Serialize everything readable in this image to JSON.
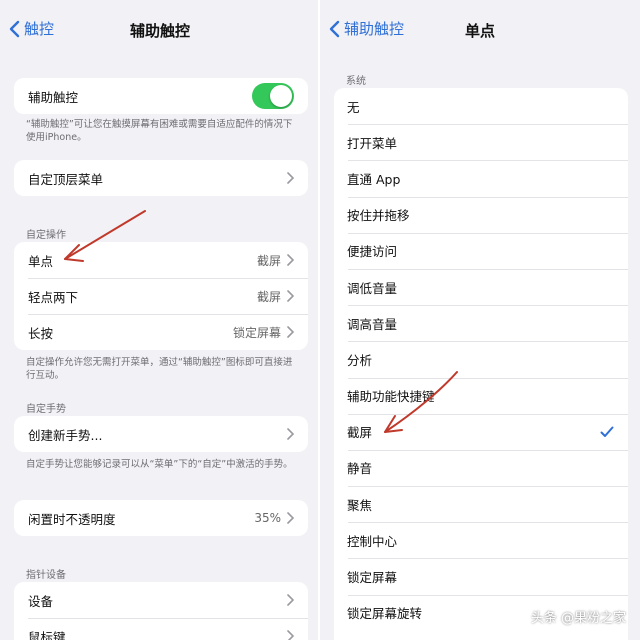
{
  "left": {
    "back_label": "触控",
    "title": "辅助触控",
    "assistive_touch": {
      "label": "辅助触控",
      "enabled": true
    },
    "assistive_note": "“辅助触控”可让您在触摸屏幕有困难或需要自适应配件的情况下使用iPhone。",
    "top_menu": {
      "label": "自定顶层菜单"
    },
    "custom_actions_header": "自定操作",
    "custom_actions": [
      {
        "label": "单点",
        "value": "截屏"
      },
      {
        "label": "轻点两下",
        "value": "截屏"
      },
      {
        "label": "长按",
        "value": "锁定屏幕"
      }
    ],
    "custom_actions_note": "自定操作允许您无需打开菜单，通过“辅助触控”图标即可直接进行互动。",
    "custom_gestures_header": "自定手势",
    "create_gesture": {
      "label": "创建新手势..."
    },
    "custom_gestures_note": "自定手势让您能够记录可以从“菜单”下的“自定”中激活的手势。",
    "idle_opacity": {
      "label": "闲置时不透明度",
      "value": "35%"
    },
    "pointer_header": "指针设备",
    "pointer_items": [
      {
        "label": "设备"
      },
      {
        "label": "鼠标键"
      }
    ]
  },
  "right": {
    "back_label": "辅助触控",
    "title": "单点",
    "section_header": "系统",
    "items": [
      {
        "label": "无",
        "checked": false
      },
      {
        "label": "打开菜单",
        "checked": false
      },
      {
        "label": "直通 App",
        "checked": false
      },
      {
        "label": "按住并拖移",
        "checked": false
      },
      {
        "label": "便捷访问",
        "checked": false
      },
      {
        "label": "调低音量",
        "checked": false
      },
      {
        "label": "调高音量",
        "checked": false
      },
      {
        "label": "分析",
        "checked": false
      },
      {
        "label": "辅助功能快捷键",
        "checked": false
      },
      {
        "label": "截屏",
        "checked": true
      },
      {
        "label": "静音",
        "checked": false
      },
      {
        "label": "聚焦",
        "checked": false
      },
      {
        "label": "控制中心",
        "checked": false
      },
      {
        "label": "锁定屏幕",
        "checked": false
      },
      {
        "label": "锁定屏幕旋转",
        "checked": false
      }
    ]
  },
  "watermark": "头条 @果粉之家",
  "colors": {
    "accent": "#2f6fd6",
    "toggle_on": "#34c759",
    "annotation": "#c0392b"
  }
}
